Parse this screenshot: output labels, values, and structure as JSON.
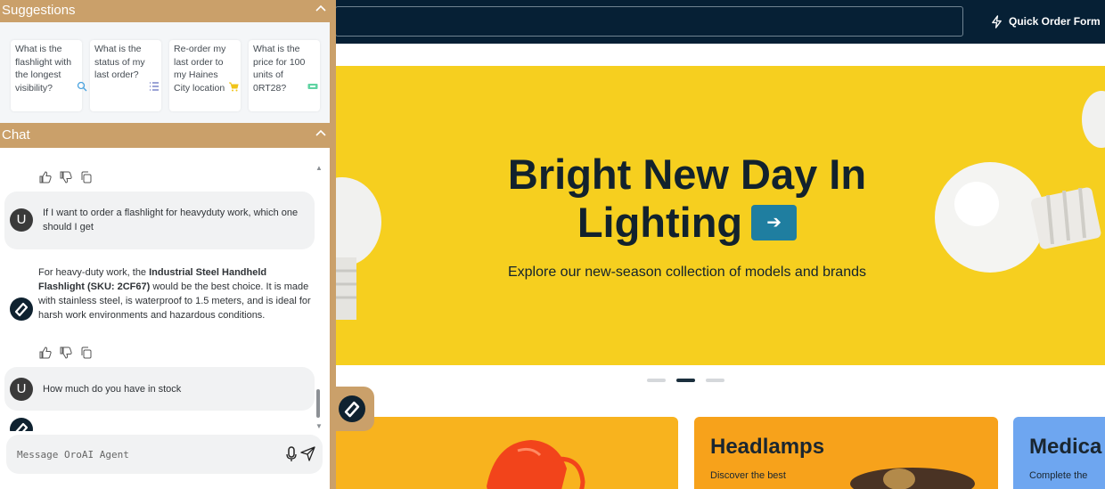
{
  "header": {
    "search_placeholder": "",
    "quick_order_label": "Quick Order Form",
    "quick_order_icon": "lightning-icon"
  },
  "hero": {
    "title_line1": "Bright New Day In",
    "title_line2": "Lighting",
    "subtitle": "Explore our new-season collection of models and brands",
    "arrow_icon": "arrow-right-icon",
    "slide_index": 2,
    "slide_count": 3
  },
  "cards": [
    {
      "title": "",
      "text": ""
    },
    {
      "title": "Headlamps",
      "text": "Discover the best"
    },
    {
      "title": "Medica",
      "text": "Complete the"
    }
  ],
  "panel": {
    "suggestions_title": "Suggestions",
    "chat_title": "Chat",
    "suggestions": [
      {
        "text": "What is the flashlight with the longest visibility?",
        "icon": "search-icon"
      },
      {
        "text": "What is the status of my last order?",
        "icon": "list-icon"
      },
      {
        "text": "Re-order my last order to my Haines City location",
        "icon": "cart-icon"
      },
      {
        "text": "What is the price for 100 units of 0RT28?",
        "icon": "price-tag-icon"
      }
    ],
    "messages": {
      "user1": "If I want to order a flashlight for heavyduty work, which one should I get",
      "bot_prefix": "For heavy-duty work, the ",
      "bot_bold": "Industrial Steel Handheld Flashlight (SKU: 2CF67)",
      "bot_suffix": " would be the best choice. It is made with stainless steel, is waterproof to 1.5 meters, and is ideal for harsh work environments and hazardous conditions.",
      "user2": "How much do you have in stock",
      "user_avatar_letter": "U"
    },
    "input_placeholder": "Message OroAI Agent"
  },
  "colors": {
    "panel_accent": "#caa06a",
    "header_bg": "#062035",
    "hero_bg": "#f6cf1f",
    "arrow_button": "#1f7ea0"
  }
}
